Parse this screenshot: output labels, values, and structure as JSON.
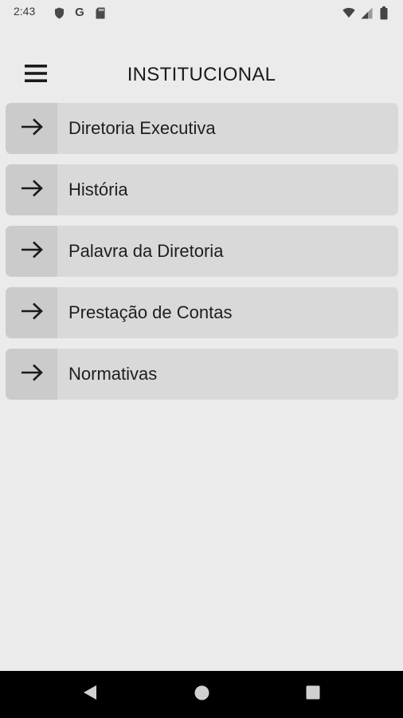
{
  "status_bar": {
    "time": "2:43",
    "left_icons": [
      "shield-icon",
      "google-g-icon",
      "sd-card-icon"
    ],
    "google_letter": "G",
    "right_icons": [
      "wifi-icon",
      "cell-signal-icon",
      "battery-icon"
    ]
  },
  "header": {
    "title": "INSTITUCIONAL",
    "menu_icon": "hamburger-menu-icon"
  },
  "menu": {
    "items": [
      {
        "label": "Diretoria Executiva",
        "icon": "arrow-right-icon"
      },
      {
        "label": "História",
        "icon": "arrow-right-icon"
      },
      {
        "label": "Palavra da Diretoria",
        "icon": "arrow-right-icon"
      },
      {
        "label": "Prestação de Contas",
        "icon": "arrow-right-icon"
      },
      {
        "label": "Normativas",
        "icon": "arrow-right-icon"
      }
    ]
  },
  "nav_bar": {
    "buttons": [
      "back-icon",
      "home-icon",
      "recents-icon"
    ]
  },
  "colors": {
    "background": "#ebebeb",
    "item_background": "#d9d9d9",
    "icon_box_background": "#cbcbcb",
    "nav_bar": "#000000"
  }
}
